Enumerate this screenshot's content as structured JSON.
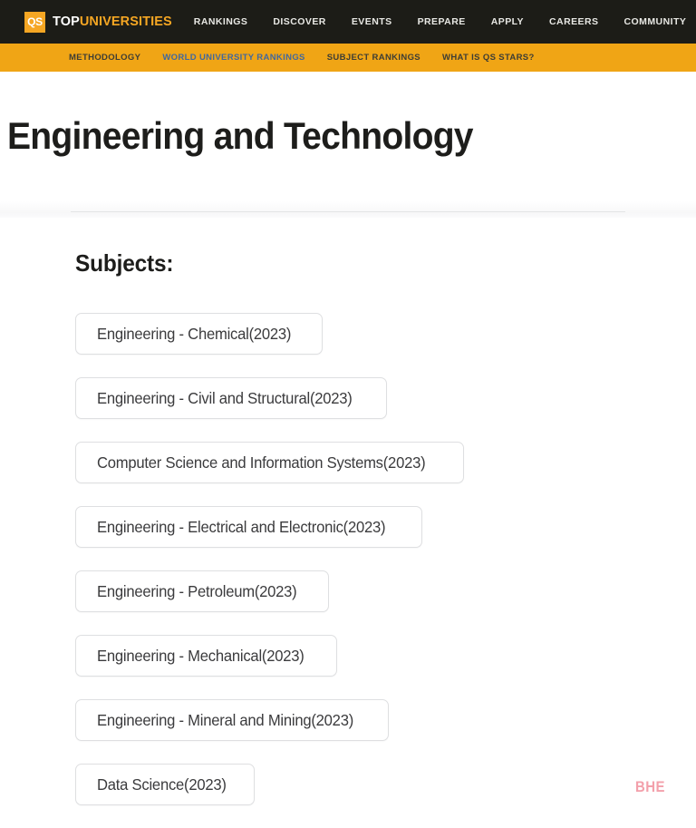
{
  "header": {
    "logo": {
      "badge_text": "QS",
      "name_part1": "TOP",
      "name_part2": "UNIVERSITIES"
    },
    "nav_items": [
      {
        "label": "RANKINGS"
      },
      {
        "label": "DISCOVER"
      },
      {
        "label": "EVENTS"
      },
      {
        "label": "PREPARE"
      },
      {
        "label": "APPLY"
      },
      {
        "label": "CAREERS"
      },
      {
        "label": "COMMUNITY"
      }
    ],
    "subnav_items": [
      {
        "label": "METHODOLOGY",
        "active": false
      },
      {
        "label": "WORLD UNIVERSITY RANKINGS",
        "active": true
      },
      {
        "label": "SUBJECT RANKINGS",
        "active": false
      },
      {
        "label": "WHAT IS QS STARS?",
        "active": false
      }
    ]
  },
  "main": {
    "page_title": "Engineering and Technology",
    "subjects_heading": "Subjects:",
    "subjects": [
      {
        "label": "Engineering - Chemical(2023)"
      },
      {
        "label": "Engineering - Civil and Structural(2023)"
      },
      {
        "label": "Computer Science and Information Systems(2023)"
      },
      {
        "label": "Engineering - Electrical and Electronic(2023)"
      },
      {
        "label": "Engineering - Petroleum(2023)"
      },
      {
        "label": "Engineering - Mechanical(2023)"
      },
      {
        "label": "Engineering - Mineral and Mining(2023)"
      },
      {
        "label": "Data Science(2023)"
      }
    ]
  },
  "watermark": {
    "text": "BHE"
  },
  "colors": {
    "nav_background": "#1c1c17",
    "subnav_background": "#f0a515",
    "brand_accent": "#f5a623",
    "subnav_active": "#41689e",
    "button_border": "#dedfe1",
    "text_primary": "#1d1d1b",
    "watermark": "#f3a0ab"
  }
}
